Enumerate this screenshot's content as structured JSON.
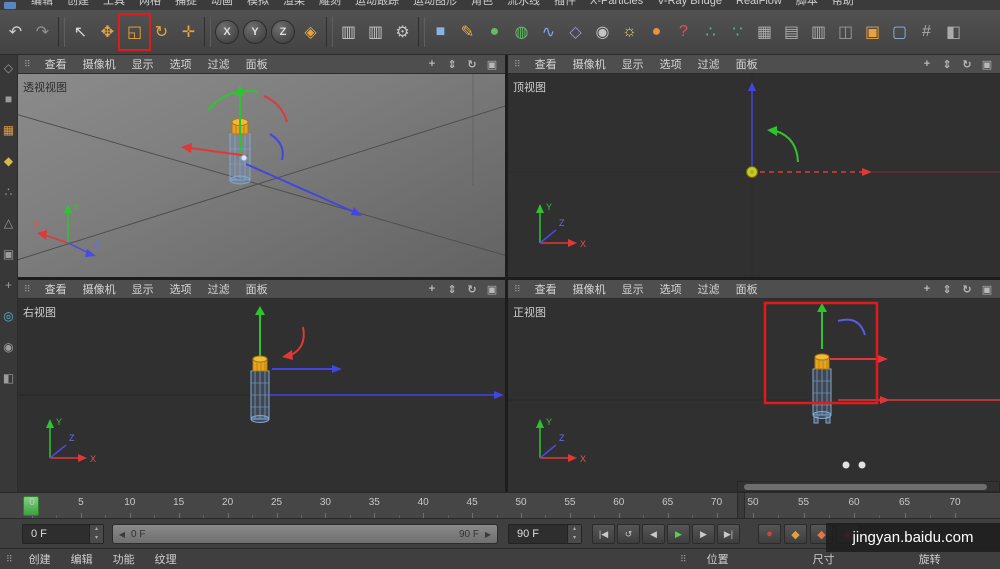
{
  "window": {
    "menu_items": [
      "编辑",
      "创建",
      "工具",
      "网格",
      "捕捉",
      "动画",
      "模拟",
      "渲染",
      "雕刻",
      "运动跟踪",
      "运动图形",
      "角色",
      "流水线",
      "插件",
      "X-Particles",
      "V-Ray Bridge",
      "RealFlow",
      "脚本",
      "帮助"
    ]
  },
  "icons": {
    "panel_grid": "⠿"
  },
  "toolbar": {
    "icons": [
      {
        "name": "undo-icon",
        "glyph": "↶",
        "color": "#cccccc"
      },
      {
        "name": "redo-icon",
        "glyph": "↷",
        "color": "#8f8f8f"
      },
      {
        "sep": true
      },
      {
        "name": "live-selection-icon",
        "glyph": "↖",
        "color": "#d8d8d8"
      },
      {
        "name": "move-tool-icon",
        "glyph": "✥",
        "color": "#e8a33d"
      },
      {
        "name": "scale-tool-icon",
        "glyph": "◱",
        "color": "#e8a33d",
        "highlight": true
      },
      {
        "name": "rotate-tool-icon",
        "glyph": "↻",
        "color": "#e8a33d"
      },
      {
        "name": "last-used-tool-icon",
        "glyph": "✛",
        "color": "#e8a33d"
      },
      {
        "sep": true
      },
      {
        "name": "x-axis-lock-button",
        "glyph": "X",
        "circle": true
      },
      {
        "name": "y-axis-lock-button",
        "glyph": "Y",
        "circle": true
      },
      {
        "name": "z-axis-lock-button",
        "glyph": "Z",
        "circle": true
      },
      {
        "name": "coordinate-system-button",
        "glyph": "◈",
        "color": "#e8a33d"
      },
      {
        "sep": true
      },
      {
        "name": "render-view-button",
        "glyph": "▥",
        "color": "#c4c4c4"
      },
      {
        "name": "render-picture-viewer-button",
        "glyph": "▥",
        "color": "#c4c4c4"
      },
      {
        "name": "render-settings-button",
        "glyph": "⚙",
        "color": "#c4c4c4"
      },
      {
        "sep": true
      },
      {
        "name": "add-cube-button",
        "glyph": "■",
        "color": "#8ab2e2"
      },
      {
        "name": "pen-tool-button",
        "glyph": "✎",
        "color": "#e0b050"
      },
      {
        "name": "add-sphere-button",
        "glyph": "●",
        "color": "#66bb66"
      },
      {
        "name": "add-generator-button",
        "glyph": "◍",
        "color": "#66bb66"
      },
      {
        "name": "add-spline-button",
        "glyph": "∿",
        "color": "#86a4ec"
      },
      {
        "name": "add-deformer-button",
        "glyph": "◇",
        "color": "#a98fd8"
      },
      {
        "name": "add-camera-button",
        "glyph": "◉",
        "color": "#c4c4c4"
      },
      {
        "name": "add-light-button",
        "glyph": "☼",
        "color": "#e8d060"
      },
      {
        "name": "add-material-button",
        "glyph": "●",
        "color": "#e8923c"
      },
      {
        "name": "help-button",
        "glyph": "?",
        "color": "#e05555"
      },
      {
        "name": "character-menu-icon",
        "glyph": "∴",
        "color": "#5ab2a2"
      },
      {
        "name": "joint-tool-icon",
        "glyph": "∵",
        "color": "#5ab2a2"
      },
      {
        "name": "mograph-cloner-icon",
        "glyph": "▦",
        "color": "#ababab"
      },
      {
        "name": "mograph-matrix-icon",
        "glyph": "▤",
        "color": "#ababab"
      },
      {
        "name": "mograph-fracture-icon",
        "glyph": "▥",
        "color": "#ababab"
      },
      {
        "name": "motion-clip-icon",
        "glyph": "◫",
        "color": "#9a9a9a"
      },
      {
        "name": "display-mode-icon",
        "glyph": "▣",
        "color": "#e8a33d"
      },
      {
        "name": "layout-browser-icon",
        "glyph": "▢",
        "color": "#8ab2e2"
      },
      {
        "name": "snap-settings-icon",
        "glyph": "#",
        "color": "#ababab"
      },
      {
        "name": "workplane-icon",
        "glyph": "◧",
        "color": "#ababab"
      }
    ]
  },
  "left_dock": {
    "icons": [
      {
        "name": "make-editable-icon",
        "glyph": "◇",
        "color": "#9c9c9c"
      },
      {
        "name": "model-mode-icon",
        "glyph": "■",
        "color": "#9c9c9c"
      },
      {
        "name": "texture-mode-icon",
        "glyph": "▦",
        "color": "#d89a46"
      },
      {
        "name": "workplane-mode-icon",
        "glyph": "◆",
        "color": "#d8b846"
      },
      {
        "name": "points-mode-icon",
        "glyph": "∴",
        "color": "#9c9c9c"
      },
      {
        "name": "edges-mode-icon",
        "glyph": "△",
        "color": "#9c9c9c"
      },
      {
        "name": "polygons-mode-icon",
        "glyph": "▣",
        "color": "#9c9c9c"
      },
      {
        "name": "enable-axis-icon",
        "glyph": "+",
        "color": "#9c9c9c"
      },
      {
        "name": "solo-mode-icon",
        "glyph": "◎",
        "color": "#5ab2c8"
      },
      {
        "name": "snap-enable-icon",
        "glyph": "◉",
        "color": "#9c9c9c"
      },
      {
        "name": "lock-workplane-icon",
        "glyph": "◧",
        "color": "#9c9c9c"
      }
    ]
  },
  "viewport_menu": [
    "查看",
    "摄像机",
    "显示",
    "选项",
    "过滤",
    "面板"
  ],
  "viewport_corner_icons": [
    {
      "name": "pan-view-icon",
      "glyph": "+"
    },
    {
      "name": "zoom-view-icon",
      "glyph": "⇕"
    },
    {
      "name": "rotate-view-icon",
      "glyph": "↻"
    },
    {
      "name": "maximize-view-icon",
      "glyph": "▣"
    }
  ],
  "viewports": {
    "perspective_label": "透视视图",
    "top_label": "顶视图",
    "right_label": "右视图",
    "front_label": "正视图"
  },
  "axes": {
    "x": "X",
    "y": "Y",
    "z": "Z"
  },
  "timeline": {
    "left_ticks": [
      "0",
      "5",
      "10",
      "15",
      "20",
      "25",
      "30",
      "35",
      "40",
      "45",
      "50",
      "55",
      "60",
      "65",
      "70"
    ],
    "right_ticks": [
      "50",
      "55",
      "60",
      "65",
      "70"
    ],
    "current_frame": "0 F",
    "end_frame": "90 F",
    "range_start_label": "0 F",
    "range_end_label": "90 F",
    "slider_left_arrow": "◀",
    "slider_right_arrow": "▶",
    "spinner_up": "▴",
    "spinner_down": "▾",
    "transport_buttons": [
      {
        "name": "goto-start-button",
        "glyph": "|◀"
      },
      {
        "name": "loop-mode-button",
        "glyph": "↺"
      },
      {
        "name": "previous-frame-button",
        "glyph": "◀"
      },
      {
        "name": "play-button",
        "glyph": "▶",
        "color": "#55cf55"
      },
      {
        "name": "next-frame-button",
        "glyph": "▶"
      },
      {
        "name": "goto-end-button",
        "glyph": "▶|"
      }
    ],
    "record_buttons": [
      {
        "name": "record-keyframe-button",
        "glyph": "●",
        "color": "#d24040"
      },
      {
        "name": "record-position-button",
        "glyph": "◆",
        "color": "#e0a040"
      },
      {
        "name": "record-scale-button",
        "glyph": "◆",
        "color": "#e07840"
      },
      {
        "name": "autokey-button",
        "glyph": "◉",
        "color": "#d24040"
      }
    ]
  },
  "material_manager": {
    "menus": [
      "创建",
      "编辑",
      "功能",
      "纹理"
    ]
  },
  "coordinate_manager": {
    "headers": [
      "位置",
      "尺寸",
      "旋转"
    ]
  },
  "watermark": "jingyan.baidu.com",
  "colors": {
    "annotation_red": "#e01b1b",
    "tool_orange": "#e8a33d",
    "play_green": "#55cf55"
  }
}
